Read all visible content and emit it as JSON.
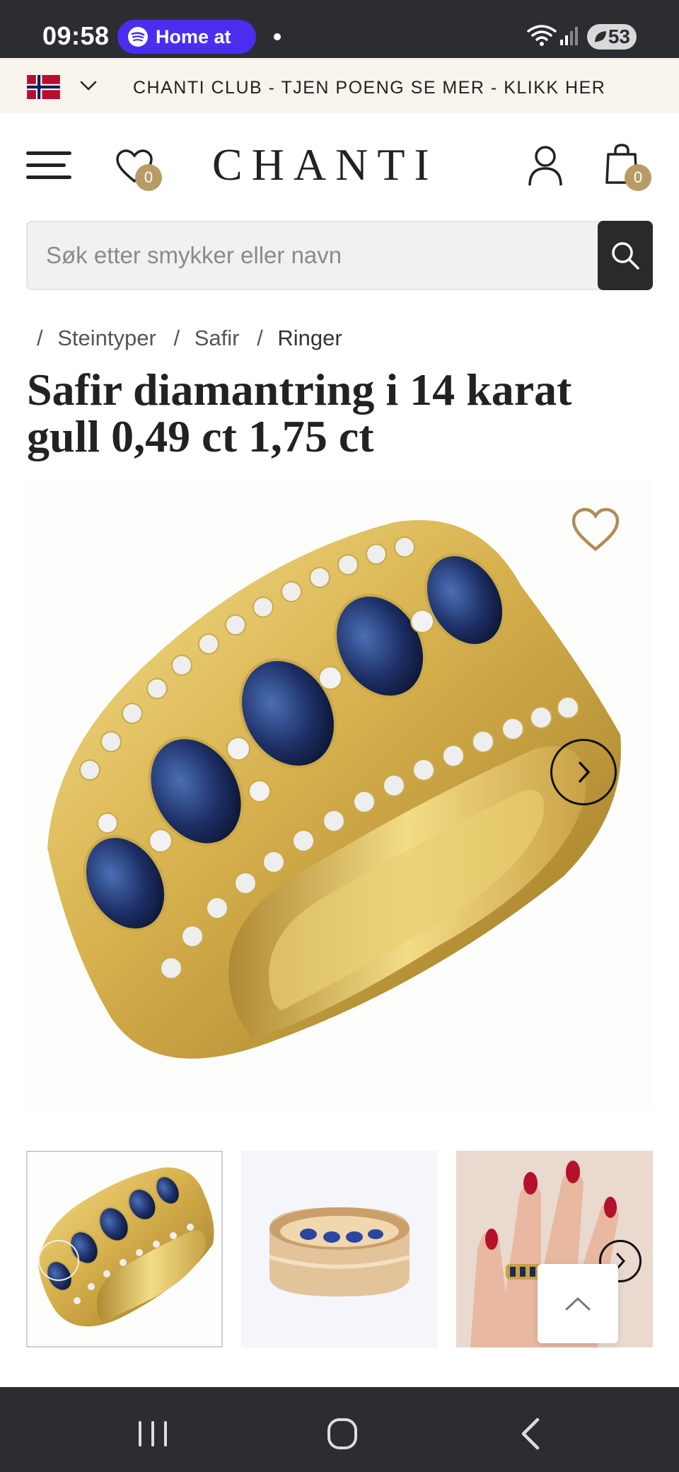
{
  "status_bar": {
    "time": "09:58",
    "media_pill": "Home at",
    "battery": "53"
  },
  "promo": {
    "text": "CHANTI CLUB - TJEN POENG SE MER - KLIKK HER"
  },
  "header": {
    "logo": "CHANTI",
    "wishlist_count": "0",
    "cart_count": "0"
  },
  "search": {
    "placeholder": "Søk etter smykker eller navn"
  },
  "breadcrumb": [
    "Steintyper",
    "Safir",
    "Ringer"
  ],
  "product": {
    "title": "Safir diamantring i 14 karat gull 0,49 ct 1,75 ct"
  },
  "colors": {
    "accent_gold": "#b79c66",
    "banner_bg": "#f8f4ec",
    "system_bar": "#2b2d31",
    "spotify_pill": "#4b2df0"
  },
  "icons": {
    "menu": "hamburger-icon",
    "wishlist": "heart-icon",
    "account": "user-icon",
    "cart": "shopping-bag-icon",
    "search": "search-icon",
    "favorite": "heart-outline-icon",
    "next": "chevron-right-icon",
    "back_to_top": "chevron-up-icon"
  }
}
